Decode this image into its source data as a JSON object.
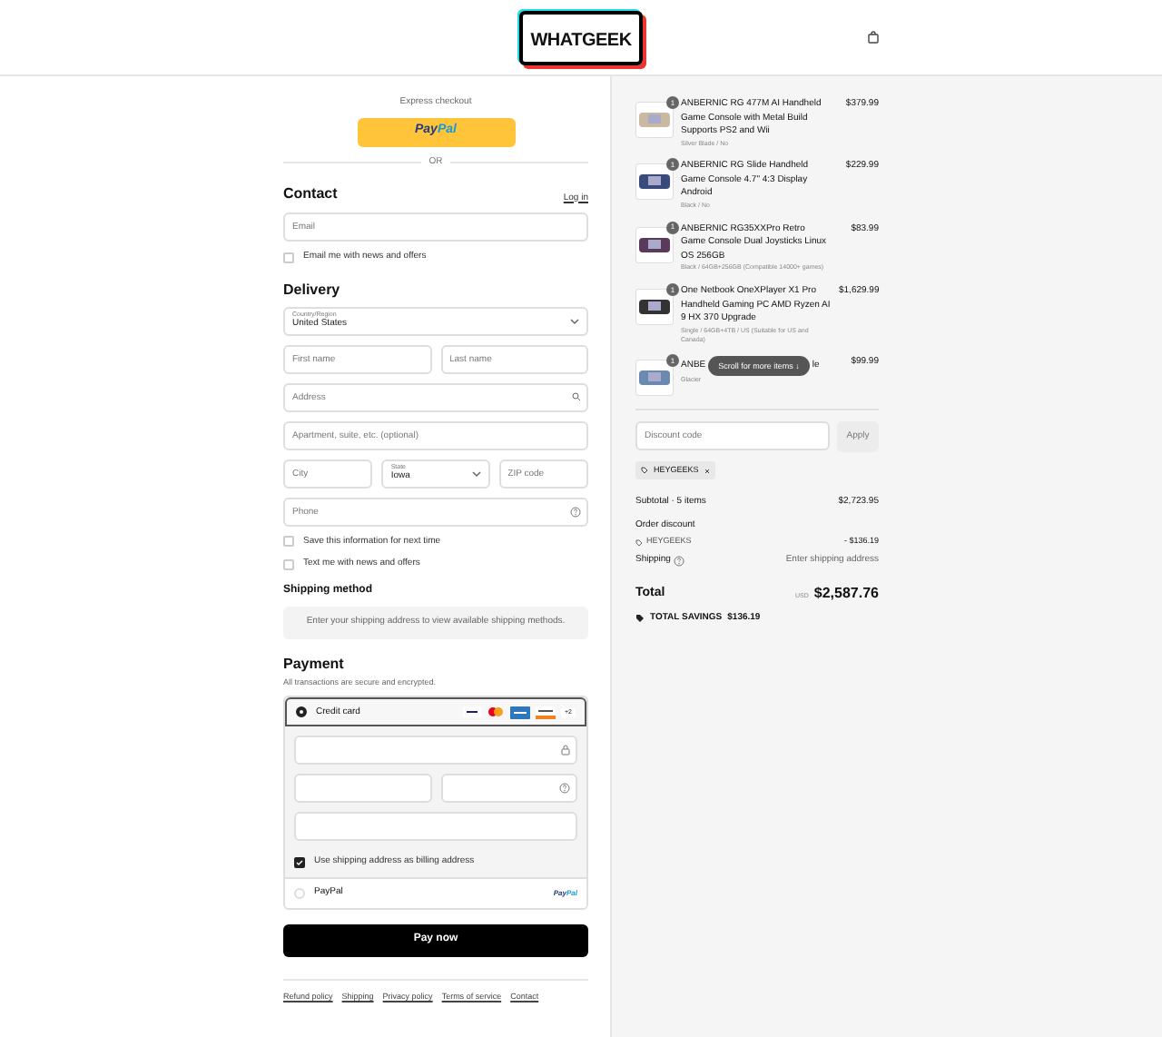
{
  "header": {
    "logo": "WHATGEEK"
  },
  "express": {
    "label": "Express checkout",
    "paypal": {
      "pay": "Pay",
      "pal": "Pal"
    },
    "divider": "OR"
  },
  "contact": {
    "title": "Contact",
    "login": "Log in",
    "email": {
      "placeholder": "Email"
    },
    "newsletter": {
      "label": "Email me with news and offers",
      "checked": false
    }
  },
  "delivery": {
    "title": "Delivery",
    "country": {
      "label": "Country/Region",
      "value": "United States"
    },
    "first_name": {
      "placeholder": "First name"
    },
    "last_name": {
      "placeholder": "Last name"
    },
    "address": {
      "placeholder": "Address"
    },
    "apartment": {
      "placeholder": "Apartment, suite, etc. (optional)"
    },
    "city": {
      "placeholder": "City"
    },
    "state": {
      "label": "State",
      "value": "Iowa"
    },
    "zip": {
      "placeholder": "ZIP code"
    },
    "phone": {
      "placeholder": "Phone"
    },
    "options": [
      {
        "label": "Save this information for next time",
        "checked": false
      },
      {
        "label": "Text me with news and offers",
        "checked": false
      }
    ]
  },
  "shipping_method": {
    "title": "Shipping method",
    "notice": "Enter your shipping address to view available shipping methods."
  },
  "payment": {
    "title": "Payment",
    "subtitle": "All transactions are secure and encrypted.",
    "methods": [
      {
        "kind": "card",
        "label": "Credit card",
        "selected": true,
        "more": "+2"
      },
      {
        "kind": "paypal",
        "label": "PayPal",
        "selected": false,
        "pay": "Pay",
        "pal": "Pal"
      }
    ],
    "billing": {
      "label": "Use shipping address as billing address",
      "checked": true
    }
  },
  "pay_button": "Pay now",
  "footer_links": [
    "Refund policy",
    "Shipping",
    "Privacy policy",
    "Terms of service",
    "Contact"
  ],
  "items": [
    {
      "qty": "1",
      "name": "ANBERNIC RG 477M AI Handheld Game Console with Metal Build Supports PS2 and Wii",
      "variant": "Silver Blade / No",
      "price": "$379.99"
    },
    {
      "qty": "1",
      "name": "ANBERNIC RG Slide Handheld Game Console 4.7\" 4:3 Display Android",
      "variant": "Black / No",
      "price": "$229.99"
    },
    {
      "qty": "1",
      "name": "ANBERNIC RG35XXPro Retro Game Console Dual Joysticks Linux OS 256GB",
      "variant": "Black / 64GB+256GB (Compatible 14000+ games)",
      "price": "$83.99"
    },
    {
      "qty": "1",
      "name": "One Netbook OneXPlayer X1 Pro Handheld Gaming PC AMD Ryzen AI 9 HX 370 Upgrade",
      "variant": "Single / 64GB+4TB / US (Suitable for US and Canada)",
      "price": "$1,629.99"
    },
    {
      "qty": "1",
      "name": "ANBE",
      "name_end": "le",
      "variant": "Glacier",
      "price": "$99.99"
    }
  ],
  "scroll_hint": "Scroll for more items ↓",
  "discount": {
    "placeholder": "Discount code",
    "apply": "Apply",
    "code": "HEYGEEKS"
  },
  "summary": {
    "subtotal_label": "Subtotal · 5 items",
    "subtotal": "$2,723.95",
    "order_discount": "Order discount",
    "code": "HEYGEEKS",
    "discount": "- $136.19",
    "shipping_label": "Shipping",
    "shipping": "Enter shipping address",
    "total_label": "Total",
    "currency": "USD",
    "total": "$2,587.76",
    "savings_label": "TOTAL SAVINGS",
    "savings": "$136.19"
  }
}
